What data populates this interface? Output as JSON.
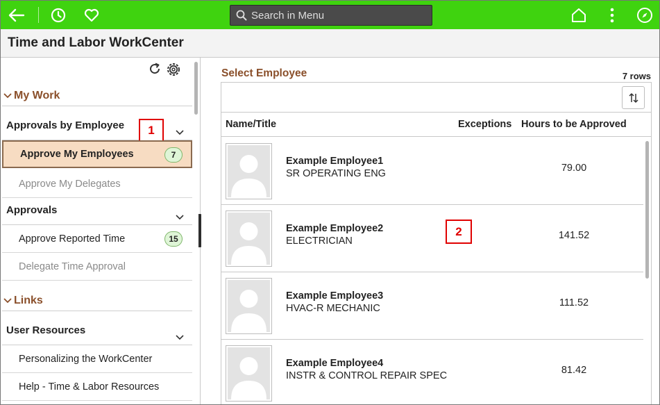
{
  "search": {
    "placeholder": "Search in Menu"
  },
  "icons": {
    "back": "back-arrow-icon",
    "recent": "clock-icon",
    "favorites": "heart-icon",
    "home": "home-icon",
    "actions": "more-vertical-icon",
    "navbar": "compass-icon",
    "refresh": "refresh-icon",
    "settings": "gear-icon",
    "sort": "sort-icon"
  },
  "colors": {
    "topbar": "#3fd30f",
    "section_heading": "#8a4f2a",
    "active_item_bg": "#f7dcc2",
    "badge_bg": "#dff5d7",
    "callout": "#e00000"
  },
  "page": {
    "title": "Time and Labor WorkCenter"
  },
  "sidebar": {
    "sections": [
      {
        "heading": "My Work",
        "groups": [
          {
            "label": "Approvals by Employee",
            "items": [
              {
                "label": "Approve My Employees",
                "badge": "7"
              },
              {
                "label": "Approve My Delegates",
                "badge": ""
              }
            ]
          },
          {
            "label": "Approvals",
            "items": [
              {
                "label": "Approve Reported Time",
                "badge": "15"
              },
              {
                "label": "Delegate Time Approval",
                "badge": ""
              }
            ]
          }
        ]
      },
      {
        "heading": "Links",
        "groups": [
          {
            "label": "User Resources",
            "items": [
              {
                "label": "Personalizing the WorkCenter"
              },
              {
                "label": "Help - Time & Labor Resources"
              }
            ]
          }
        ]
      }
    ]
  },
  "callouts": {
    "one": "1",
    "two": "2"
  },
  "main": {
    "title": "Select Employee",
    "row_count": "7 rows",
    "columns": {
      "name": "Name/Title",
      "exceptions": "Exceptions",
      "hours": "Hours to be Approved"
    },
    "employees": [
      {
        "name": "Example Employee1",
        "title": "SR OPERATING ENG",
        "hours": "79.00"
      },
      {
        "name": "Example Employee2",
        "title": "ELECTRICIAN",
        "hours": "141.52"
      },
      {
        "name": "Example Employee3",
        "title": "HVAC-R MECHANIC",
        "hours": "111.52"
      },
      {
        "name": "Example Employee4",
        "title": "INSTR & CONTROL REPAIR SPEC",
        "hours": "81.42"
      }
    ]
  }
}
